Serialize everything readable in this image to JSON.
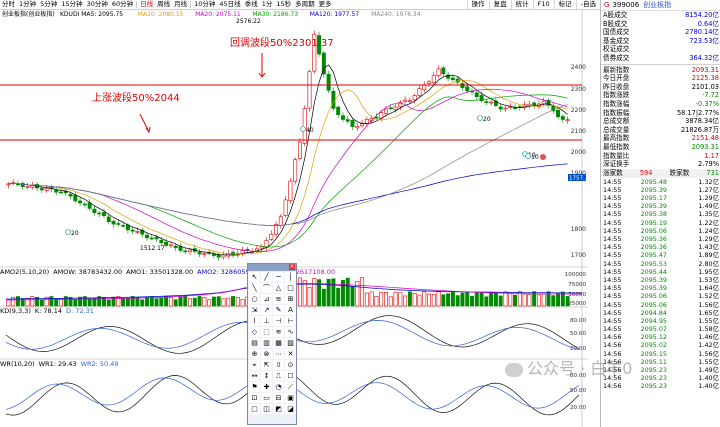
{
  "toolbar": {
    "tabs": [
      "分时",
      "1分钟",
      "5分钟",
      "15分钟",
      "30分钟",
      "60分钟",
      "日线",
      "周线",
      "月线",
      "10分钟",
      "45日线",
      "季线",
      "1分",
      "15秒",
      "多周期",
      "更多"
    ],
    "active_index": 6,
    "right_buttons": [
      "操作",
      "复盘",
      "统计",
      "F10",
      "标记",
      "-自选"
    ]
  },
  "chart": {
    "index_name": "创业板指(创业板指)",
    "ma_legend": [
      {
        "label": "KDUDI MA5: 2095.75",
        "color": "#000000"
      },
      {
        "label": "MA10: 2080.15",
        "color": "#e0a000"
      },
      {
        "label": "MA20: 2075.11",
        "color": "#d000d0"
      },
      {
        "label": "MA30: 2186.73",
        "color": "#00a000"
      },
      {
        "label": "MA120: 1977.57",
        "color": "#0000d0"
      },
      {
        "label": "MA240: 1976.34",
        "color": "#888888"
      }
    ],
    "annotation_left": "上涨波段50%2044",
    "annotation_top": "回调波段50%2301.37",
    "high_label": "2576.22",
    "low_label": "1512.17",
    "price_badge": "1757.3",
    "y_ticks": [
      "2400",
      "2300",
      "2200",
      "2100",
      "2000",
      "1900",
      "1800",
      "1700"
    ],
    "marker_labels": [
      "20",
      "10",
      "40",
      "20",
      "10"
    ]
  },
  "indicators": {
    "amo_head": [
      "AMO2(5,10,20)",
      "AMOW: 38783432.00",
      "AMO1: 33501328.00",
      "AMO2: 32860554.00",
      "AMO3: 32617108.00"
    ],
    "amo_ticks": [
      "100000",
      "75000",
      "50000",
      "25000"
    ],
    "kd_head": [
      "KD(9,3,3)",
      "K: 78.14",
      "D: 72.31"
    ],
    "kd_ticks": [
      "80.00",
      "50.00",
      "20.00"
    ],
    "wr_head": [
      "WR(10,20)",
      "WR1: 29.43",
      "WR2: 50.49"
    ],
    "wr_ticks": [
      "80.00",
      "50.00",
      "20.00"
    ],
    "colors": {
      "up": "#e00000",
      "down": "#008a00",
      "line_blue": "#2f62d8",
      "line_black": "#111111"
    }
  },
  "panel": {
    "g_label": "G",
    "code": "399006",
    "name": "创业板指",
    "stats": [
      {
        "k": "A股成交",
        "v": "8154.20亿",
        "c": "blu"
      },
      {
        "k": "B股成交",
        "v": "0.64亿",
        "c": "blu"
      },
      {
        "k": "国债成交",
        "v": "2780.14亿",
        "c": "blu"
      },
      {
        "k": "基金成交",
        "v": "723.53亿",
        "c": "blu"
      },
      {
        "k": "权证成交",
        "v": "",
        "c": "blu"
      },
      {
        "k": "债券成交",
        "v": "364.32亿",
        "c": "blu"
      },
      {
        "k": "最新指数",
        "v": "2093.31",
        "c": "red"
      },
      {
        "k": "今日开盘",
        "v": "2125.38",
        "c": "red"
      },
      {
        "k": "昨日收盘",
        "v": "2101.03",
        "c": ""
      },
      {
        "k": "指数涨跌",
        "v": "-7.72",
        "c": "grn"
      },
      {
        "k": "指数涨幅",
        "v": "-0.37%",
        "c": "grn"
      },
      {
        "k": "指数振幅",
        "v": "58.17|2.77%",
        "c": ""
      },
      {
        "k": "总成交额",
        "v": "3878.34亿",
        "c": ""
      },
      {
        "k": "总成交量",
        "v": "21826.87万",
        "c": ""
      },
      {
        "k": "最高指数",
        "v": "2151.48",
        "c": "red"
      },
      {
        "k": "最低指数",
        "v": "2093.31",
        "c": "grn"
      },
      {
        "k": "指数量比",
        "v": "1.17",
        "c": "red"
      },
      {
        "k": "深证换手",
        "v": "2.79%",
        "c": ""
      }
    ],
    "compare": {
      "up_label": "涨家数",
      "up": "594",
      "down_label": "跌家数",
      "down": "731"
    },
    "ticks": [
      {
        "t": "14:55",
        "p": "2095.48",
        "v": "1.32亿"
      },
      {
        "t": "14:55",
        "p": "2095.39",
        "v": "1.27亿"
      },
      {
        "t": "14:55",
        "p": "2095.17",
        "v": "1.29亿"
      },
      {
        "t": "14:55",
        "p": "2095.39",
        "v": "1.49亿"
      },
      {
        "t": "14:55",
        "p": "2095.38",
        "v": "1.35亿"
      },
      {
        "t": "14:55",
        "p": "2095.19",
        "v": "1.22亿"
      },
      {
        "t": "14:55",
        "p": "2095.06",
        "v": "1.24亿"
      },
      {
        "t": "14:55",
        "p": "2095.36",
        "v": "1.29亿"
      },
      {
        "t": "14:55",
        "p": "2095.36",
        "v": "1.43亿"
      },
      {
        "t": "14:55",
        "p": "2095.47",
        "v": "1.89亿"
      },
      {
        "t": "14:55",
        "p": "2095.53",
        "v": "2.80亿"
      },
      {
        "t": "14:55",
        "p": "2095.44",
        "v": "1.95亿"
      },
      {
        "t": "14:55",
        "p": "2095.39",
        "v": "1.53亿"
      },
      {
        "t": "14:55",
        "p": "2095.39",
        "v": "1.64亿"
      },
      {
        "t": "14:55",
        "p": "2095.06",
        "v": "1.52亿"
      },
      {
        "t": "14:55",
        "p": "2095.06",
        "v": "1.56亿"
      },
      {
        "t": "14:55",
        "p": "2094.84",
        "v": "1.65亿"
      },
      {
        "t": "14:55",
        "p": "2094.95",
        "v": "1.55亿"
      },
      {
        "t": "14:55",
        "p": "2095.07",
        "v": "1.58亿"
      },
      {
        "t": "14:56",
        "p": "2095.12",
        "v": "1.46亿"
      },
      {
        "t": "14:56",
        "p": "2095.02",
        "v": "1.42亿"
      },
      {
        "t": "14:56",
        "p": "2095.15",
        "v": "1.56亿"
      },
      {
        "t": "14:56",
        "p": "2095.11",
        "v": "1.55亿"
      },
      {
        "t": "14:56",
        "p": "2095.23",
        "v": "1.49亿"
      },
      {
        "t": "14:56",
        "p": "2095.23",
        "v": "1.40亿"
      },
      {
        "t": "14:56",
        "p": "2095.23",
        "v": "1.40亿"
      }
    ]
  },
  "watermark": "公众号 · 白羊0"
}
